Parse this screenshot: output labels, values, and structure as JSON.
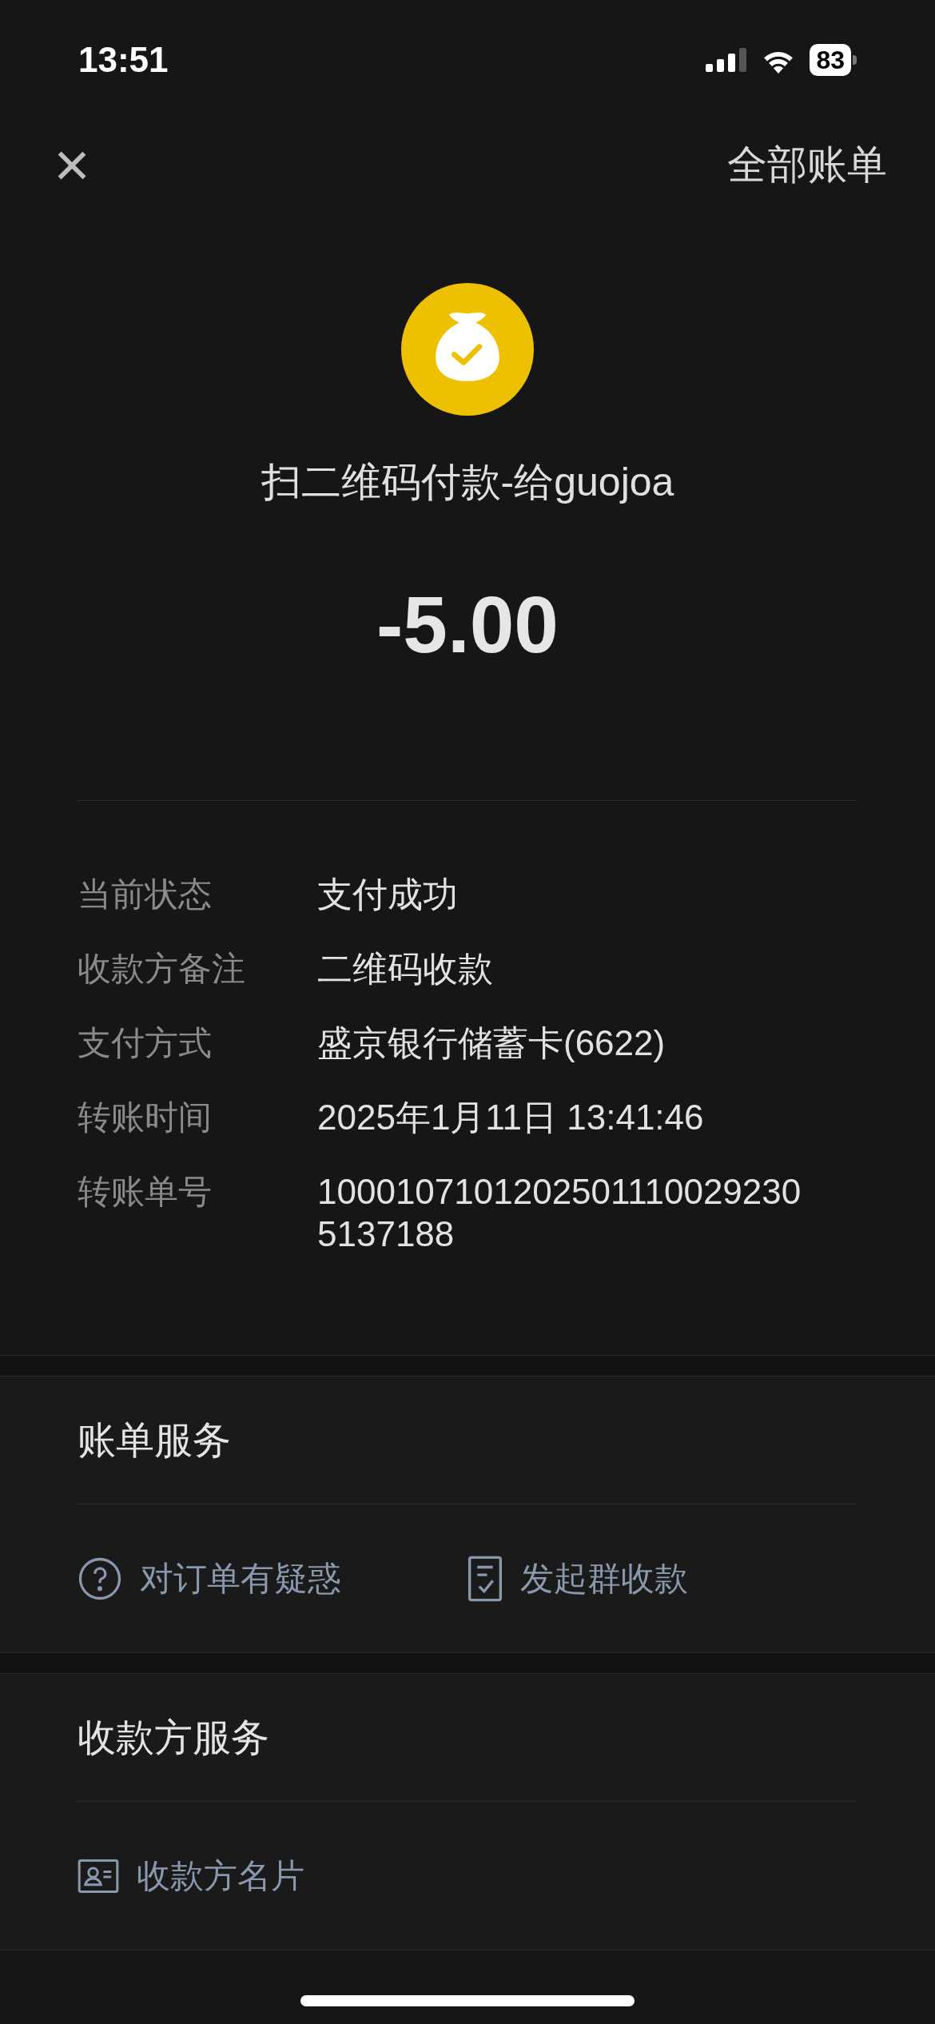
{
  "status_bar": {
    "time": "13:51",
    "battery": "83"
  },
  "nav": {
    "close": "×",
    "right_link": "全部账单"
  },
  "payment": {
    "title": "扫二维码付款-给guojoa",
    "amount": "-5.00"
  },
  "details": [
    {
      "label": "当前状态",
      "value": "支付成功"
    },
    {
      "label": "收款方备注",
      "value": "二维码收款"
    },
    {
      "label": "支付方式",
      "value": "盛京银行储蓄卡(6622)"
    },
    {
      "label": "转账时间",
      "value": "2025年1月11日 13:41:46"
    },
    {
      "label": "转账单号",
      "value": "10001071012025011100292305137188"
    }
  ],
  "bill_services": {
    "title": "账单服务",
    "actions": [
      {
        "kind": "question",
        "label": "对订单有疑惑"
      },
      {
        "kind": "receipt",
        "label": "发起群收款"
      }
    ]
  },
  "payee_services": {
    "title": "收款方服务",
    "actions": [
      {
        "kind": "card",
        "label": "收款方名片"
      }
    ]
  }
}
